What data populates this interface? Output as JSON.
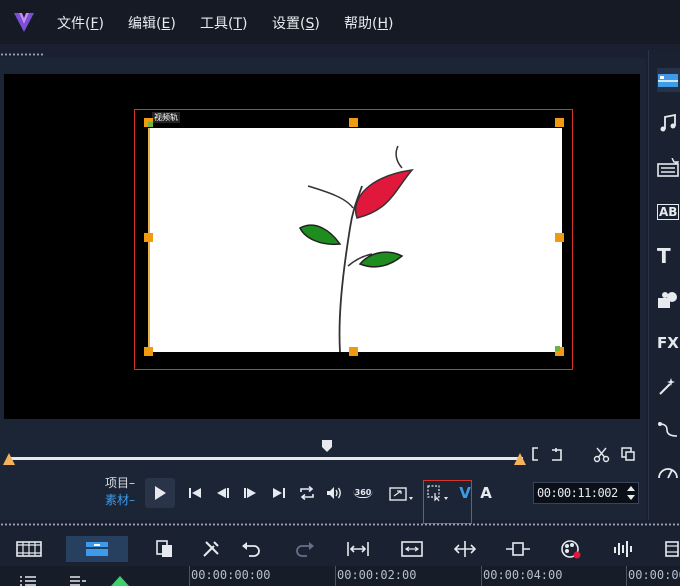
{
  "menu": {
    "items": [
      {
        "label": "文件(",
        "key": "F",
        "end": ")"
      },
      {
        "label": "编辑(",
        "key": "E",
        "end": ")"
      },
      {
        "label": "工具(",
        "key": "T",
        "end": ")"
      },
      {
        "label": "设置(",
        "key": "S",
        "end": ")"
      },
      {
        "label": "帮助(",
        "key": "H",
        "end": ")"
      }
    ]
  },
  "preview": {
    "track_label": "视频轨"
  },
  "playback": {
    "mode_project": "项目",
    "mode_clip": "素材",
    "timecode": "00:00:11:002",
    "badge_360": "360",
    "letter_v": "V",
    "letter_a": "A",
    "scrub_position": 0.62
  },
  "library_tabs": [
    {
      "icon": "media-icon"
    },
    {
      "icon": "audio-note-icon"
    },
    {
      "icon": "instant-project-icon"
    },
    {
      "icon": "transition-icon",
      "text": "AB"
    },
    {
      "icon": "title-icon",
      "text": "T"
    },
    {
      "icon": "graphics-icon"
    },
    {
      "icon": "filter-icon",
      "text": "FX"
    },
    {
      "icon": "overlay-icon"
    },
    {
      "icon": "path-icon"
    },
    {
      "icon": "speed-icon"
    }
  ],
  "timeline_ruler": {
    "ticks": [
      "00:00:00:00",
      "00:00:02:00",
      "00:00:04:00",
      "00:00:06"
    ]
  },
  "colors": {
    "accent_blue": "#3d9bea",
    "handle_orange": "#f09a12",
    "selection_red": "#d9342b",
    "petal_red": "#e0183c",
    "leaf_green": "#1e8c1e"
  }
}
